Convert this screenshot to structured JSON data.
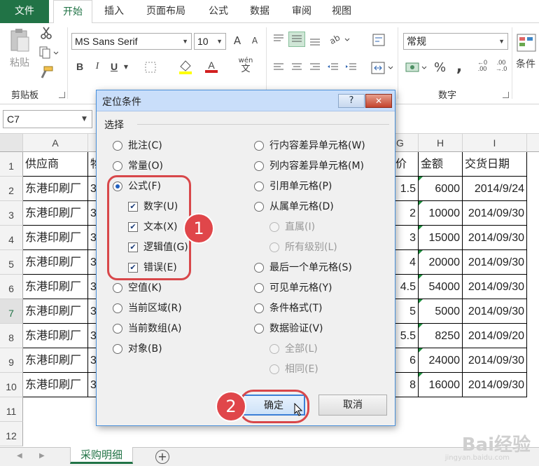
{
  "ribbon_tabs": [
    "文件",
    "开始",
    "插入",
    "页面布局",
    "公式",
    "数据",
    "审阅",
    "视图"
  ],
  "active_tab": "开始",
  "clipboard": {
    "paste_label": "粘贴",
    "group_label": "剪贴板"
  },
  "font": {
    "name": "MS Sans Serif",
    "size": "10",
    "bold": "B",
    "italic": "I",
    "underline": "U",
    "grow": "A",
    "shrink": "A",
    "fill_letter": "A",
    "wen": "wén",
    "wen_char": "文"
  },
  "number": {
    "format": "常规",
    "group_label": "数字",
    "percent": "%",
    "comma": ","
  },
  "styles": {
    "cond_format": "条件"
  },
  "name_box": "C7",
  "columns": [
    "A",
    "G",
    "H",
    "I"
  ],
  "header_row": {
    "a": "供应商",
    "b": "物",
    "g": "单价",
    "h": "金额",
    "i": "交货日期"
  },
  "rows": [
    {
      "num": "2",
      "a": "东港印刷厂",
      "b": "3",
      "g": "1.5",
      "h": "6000",
      "i": "2014/9/24"
    },
    {
      "num": "3",
      "a": "东港印刷厂",
      "b": "3",
      "g": "2",
      "h": "10000",
      "i": "2014/09/30"
    },
    {
      "num": "4",
      "a": "东港印刷厂",
      "b": "3",
      "g": "3",
      "h": "15000",
      "i": "2014/09/30"
    },
    {
      "num": "5",
      "a": "东港印刷厂",
      "b": "3",
      "g": "4",
      "h": "20000",
      "i": "2014/09/30"
    },
    {
      "num": "6",
      "a": "东港印刷厂",
      "b": "3",
      "g": "4.5",
      "h": "54000",
      "i": "2014/09/30"
    },
    {
      "num": "7",
      "a": "东港印刷厂",
      "b": "3",
      "g": "5",
      "h": "5000",
      "i": "2014/09/30"
    },
    {
      "num": "8",
      "a": "东港印刷厂",
      "b": "3",
      "g": "5.5",
      "h": "8250",
      "i": "2014/09/20"
    },
    {
      "num": "9",
      "a": "东港印刷厂",
      "b": "3",
      "g": "6",
      "h": "24000",
      "i": "2014/09/30"
    },
    {
      "num": "10",
      "a": "东港印刷厂",
      "b": "3",
      "g": "8",
      "h": "16000",
      "i": "2014/09/30"
    }
  ],
  "row_labels": [
    "1",
    "11",
    "12"
  ],
  "sheet_tab": "采购明细",
  "dialog": {
    "title": "定位条件",
    "help": "?",
    "close": "✕",
    "section": "选择",
    "left_options": [
      {
        "label": "批注(C)",
        "type": "radio",
        "checked": false
      },
      {
        "label": "常量(O)",
        "type": "radio",
        "checked": false
      },
      {
        "label": "公式(F)",
        "type": "radio",
        "checked": true
      },
      {
        "label": "数字(U)",
        "type": "check",
        "checked": true
      },
      {
        "label": "文本(X)",
        "type": "check",
        "checked": true
      },
      {
        "label": "逻辑值(G)",
        "type": "check",
        "checked": true
      },
      {
        "label": "错误(E)",
        "type": "check",
        "checked": true
      },
      {
        "label": "空值(K)",
        "type": "radio",
        "checked": false
      },
      {
        "label": "当前区域(R)",
        "type": "radio",
        "checked": false
      },
      {
        "label": "当前数组(A)",
        "type": "radio",
        "checked": false
      },
      {
        "label": "对象(B)",
        "type": "radio",
        "checked": false
      }
    ],
    "right_options": [
      {
        "label": "行内容差异单元格(W)",
        "type": "radio",
        "checked": false,
        "disabled": false
      },
      {
        "label": "列内容差异单元格(M)",
        "type": "radio",
        "checked": false,
        "disabled": false
      },
      {
        "label": "引用单元格(P)",
        "type": "radio",
        "checked": false,
        "disabled": false
      },
      {
        "label": "从属单元格(D)",
        "type": "radio",
        "checked": false,
        "disabled": false
      },
      {
        "label": "直属(I)",
        "type": "radio",
        "checked": false,
        "disabled": true
      },
      {
        "label": "所有级别(L)",
        "type": "radio",
        "checked": false,
        "disabled": true
      },
      {
        "label": "最后一个单元格(S)",
        "type": "radio",
        "checked": false,
        "disabled": false
      },
      {
        "label": "可见单元格(Y)",
        "type": "radio",
        "checked": false,
        "disabled": false
      },
      {
        "label": "条件格式(T)",
        "type": "radio",
        "checked": false,
        "disabled": false
      },
      {
        "label": "数据验证(V)",
        "type": "radio",
        "checked": false,
        "disabled": false
      },
      {
        "label": "全部(L)",
        "type": "radio",
        "checked": false,
        "disabled": true
      },
      {
        "label": "相同(E)",
        "type": "radio",
        "checked": false,
        "disabled": true
      }
    ],
    "ok": "确定",
    "cancel": "取消"
  },
  "callouts": [
    "1",
    "2"
  ],
  "watermark": {
    "logo": "Bai经验",
    "url": "jingyan.baidu.com"
  },
  "colors": {
    "excel_green": "#217346",
    "callout_red": "#e0464a",
    "dialog_title": "#c9defa"
  }
}
